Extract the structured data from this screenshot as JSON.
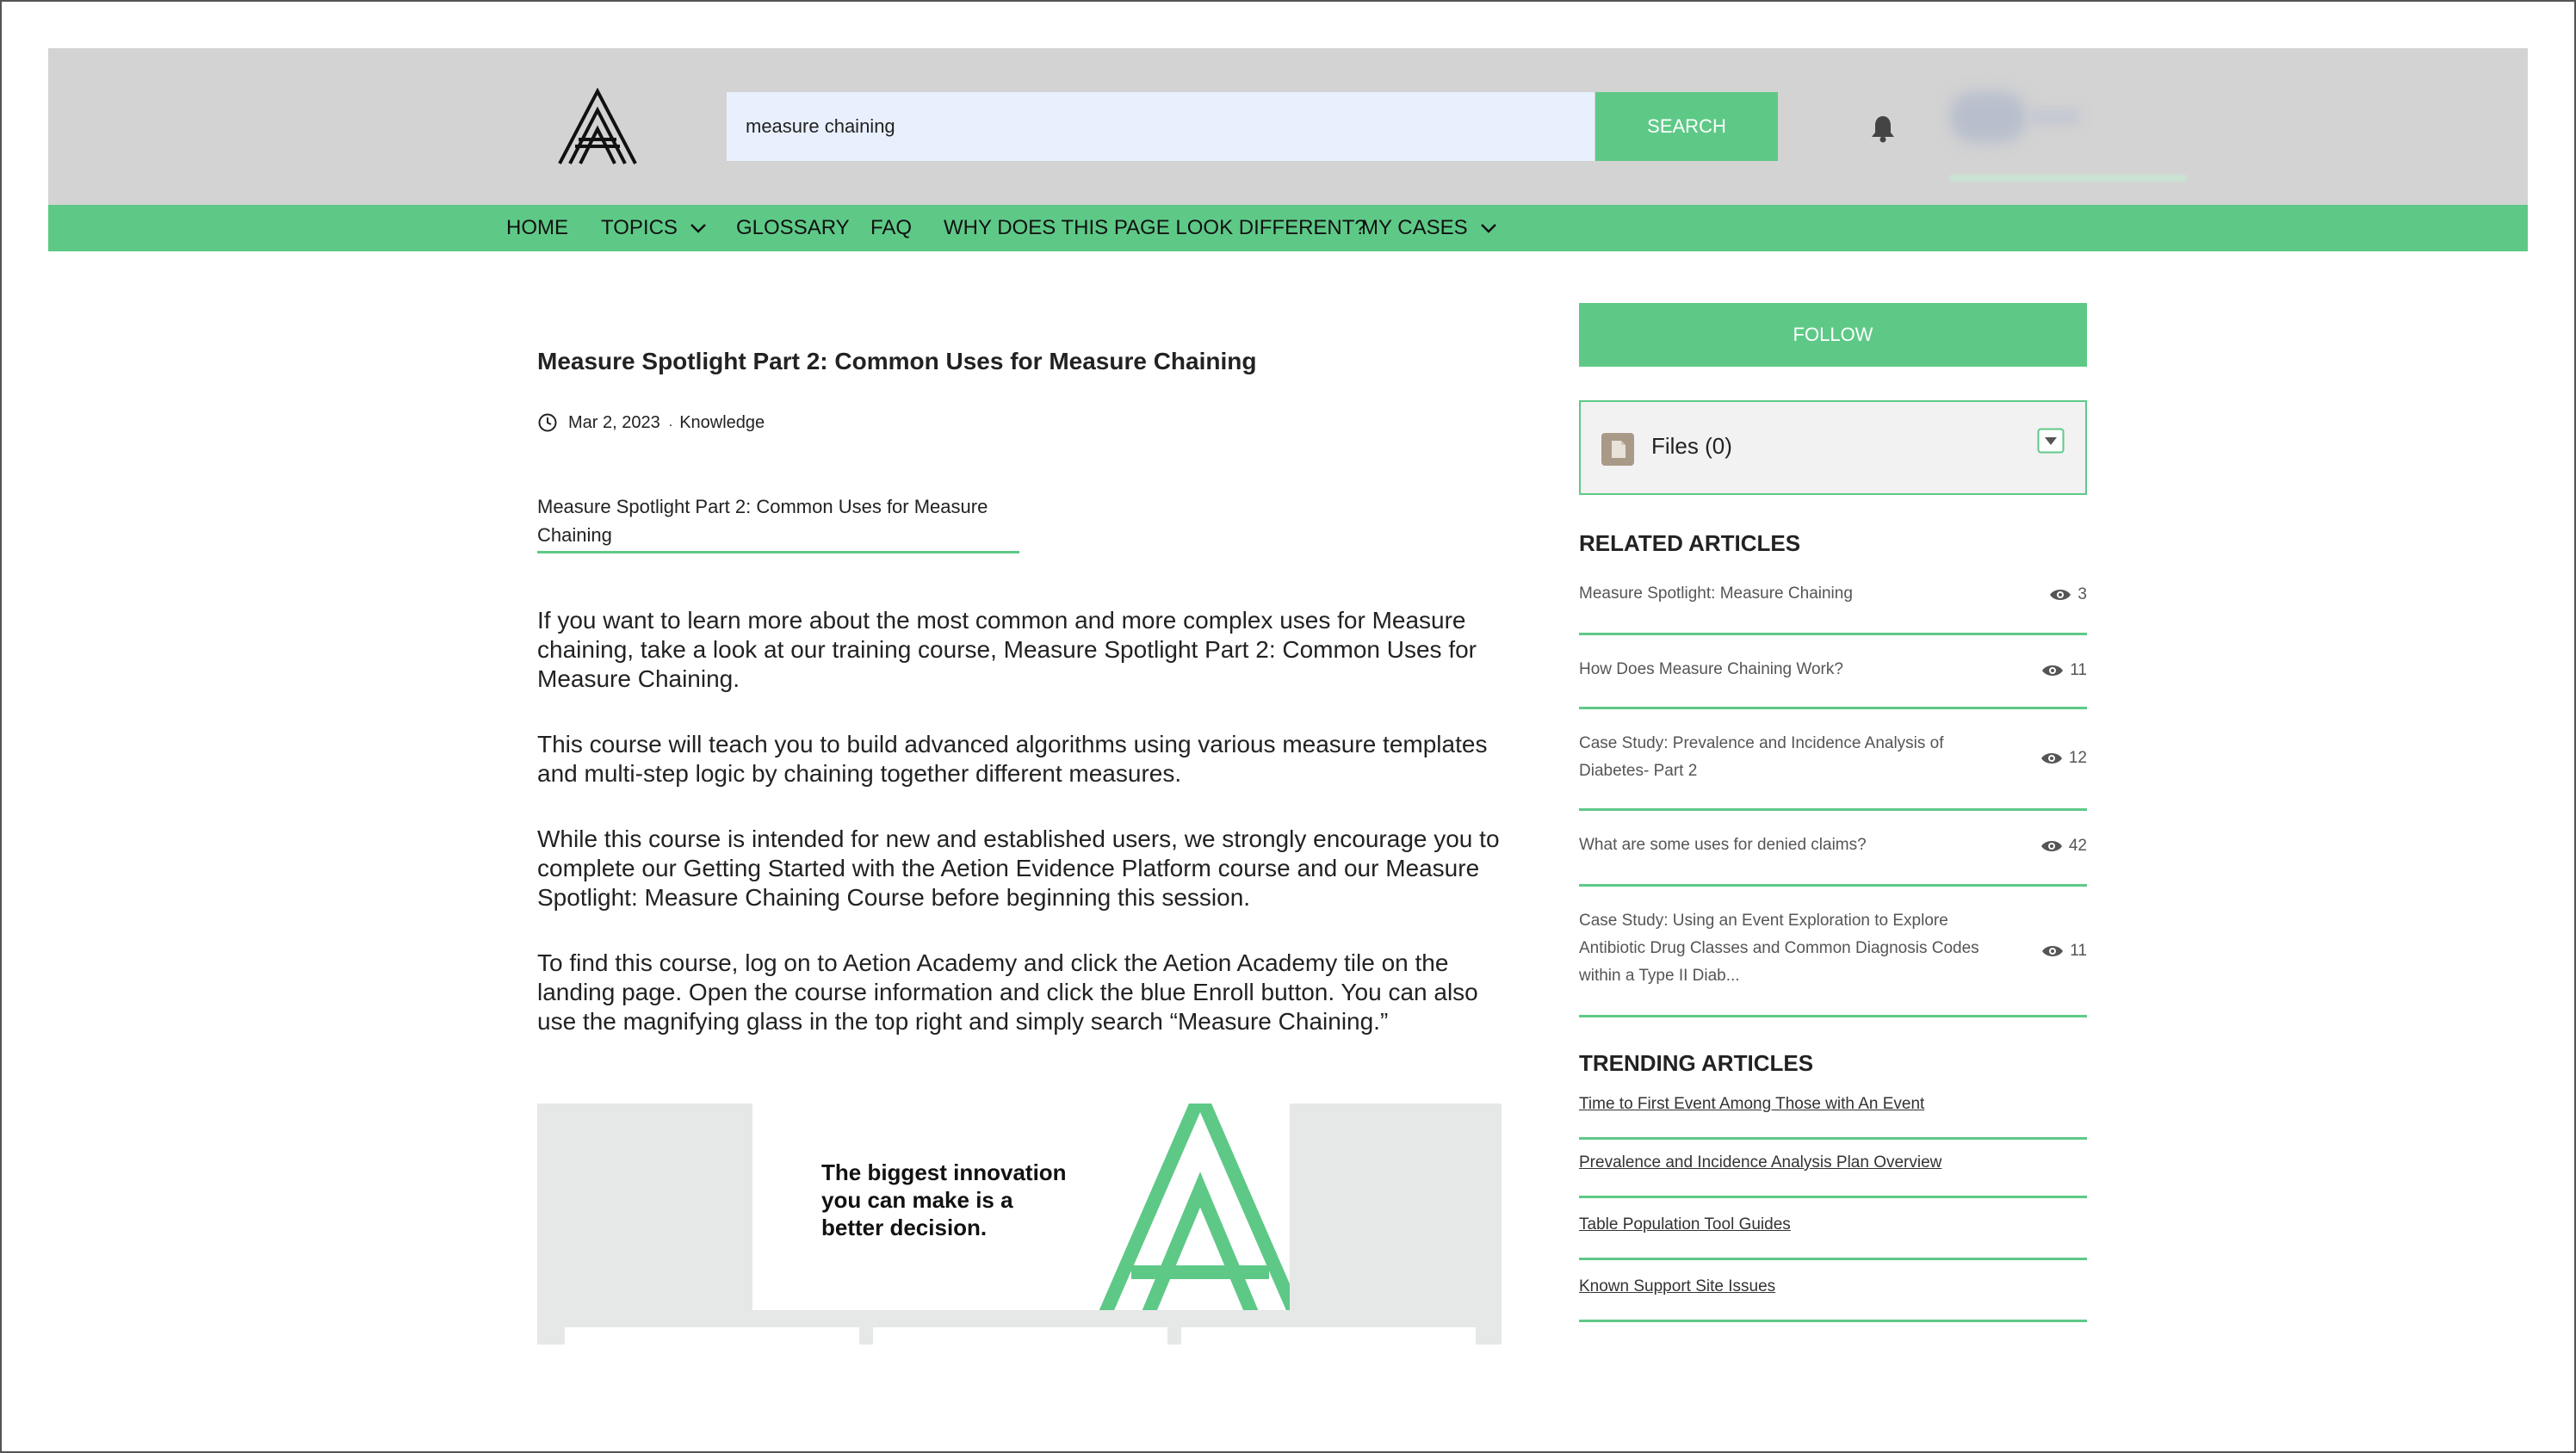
{
  "header": {
    "search": {
      "value": "measure chaining",
      "button_label": "SEARCH"
    }
  },
  "nav": {
    "items": [
      {
        "label": "HOME",
        "has_dropdown": false
      },
      {
        "label": "TOPICS",
        "has_dropdown": true
      },
      {
        "label": "GLOSSARY",
        "has_dropdown": false
      },
      {
        "label": "FAQ",
        "has_dropdown": false
      },
      {
        "label": "WHY DOES THIS PAGE LOOK DIFFERENT?",
        "has_dropdown": false
      },
      {
        "label": "MY CASES",
        "has_dropdown": true
      }
    ]
  },
  "article": {
    "title": "Measure Spotlight Part 2: Common Uses for Measure Chaining",
    "date": "Mar 2, 2023",
    "meta_separator": ".",
    "type": "Knowledge",
    "attachment_link": "Measure Spotlight Part 2: Common Uses for Measure Chaining",
    "paragraphs": [
      "If you want to learn more about the most common and more complex uses for Measure chaining, take a look at our training course, Measure Spotlight Part 2: Common Uses for Measure Chaining.",
      "This course will teach you to build advanced algorithms using various measure templates and multi-step logic by chaining together different measures.",
      "While this course is intended for new and established users, we strongly encourage you to complete our Getting Started with the Aetion Evidence Platform course and our Measure Spotlight: Measure Chaining Course before beginning this session.",
      "To find this course, log on to Aetion Academy and click the Aetion Academy tile on the landing page. Open the course information and click the blue Enroll button. You can also use the magnifying glass in the top right and simply search “Measure Chaining.”"
    ],
    "hero": {
      "tagline_lines": [
        "The biggest innovation",
        "you can make is a",
        "better decision."
      ]
    }
  },
  "sidebar": {
    "follow_label": "FOLLOW",
    "files_label": "Files (0)",
    "related_title": "RELATED ARTICLES",
    "related": [
      {
        "title": "Measure Spotlight: Measure Chaining",
        "views": "3"
      },
      {
        "title": "How Does Measure Chaining Work?",
        "views": "11"
      },
      {
        "title": "Case Study: Prevalence and Incidence Analysis of Diabetes- Part 2",
        "views": "12"
      },
      {
        "title": "What are some uses for denied claims?",
        "views": "42"
      },
      {
        "title": "Case Study: Using an Event Exploration to Explore Antibiotic Drug Classes and Common Diagnosis Codes within a Type II Diab...",
        "views": "11"
      }
    ],
    "trending_title": "TRENDING ARTICLES",
    "trending": [
      "Time to First Event Among Those with An Event",
      "Prevalence and Incidence Analysis Plan Overview",
      "Table Population Tool Guides",
      "Known Support Site Issues"
    ]
  },
  "colors": {
    "accent": "#5ec987",
    "header_bg": "#d3d3d3",
    "search_bg": "#e8f0fe"
  },
  "icons": [
    "aetion-logo",
    "bell-icon",
    "chevron-down-icon",
    "clock-icon",
    "file-icon",
    "dropdown-toggle-icon",
    "eye-icon"
  ]
}
